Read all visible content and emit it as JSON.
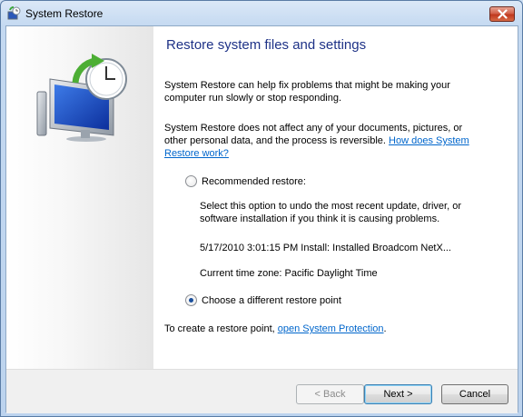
{
  "window": {
    "title": "System Restore"
  },
  "main": {
    "heading": "Restore system files and settings",
    "intro": "System Restore can help fix problems that might be making your computer run slowly or stop responding.",
    "note_text": "System Restore does not affect any of your documents, pictures, or other personal data, and the process is reversible.",
    "note_link": "How does System Restore work?",
    "recommended": {
      "label": "Recommended restore:",
      "selected": false,
      "description": "Select this option to undo the most recent update, driver, or software installation if you think it is causing problems.",
      "restore_point": "5/17/2010 3:01:15 PM  Install: Installed Broadcom NetX...",
      "timezone": "Current time zone: Pacific Daylight Time"
    },
    "different": {
      "label": "Choose a different restore point",
      "selected": true
    },
    "create_text": "To create a restore point, ",
    "create_link": "open System Protection",
    "create_end": "."
  },
  "buttons": {
    "back": "< Back",
    "next": "Next >",
    "cancel": "Cancel"
  },
  "icons": {
    "title": "system-restore-icon",
    "hero": "system-restore-monitor-clock-icon",
    "close": "close-icon"
  },
  "colors": {
    "heading": "#1e3287",
    "link": "#0066cc",
    "close_button": "#c0391f"
  }
}
